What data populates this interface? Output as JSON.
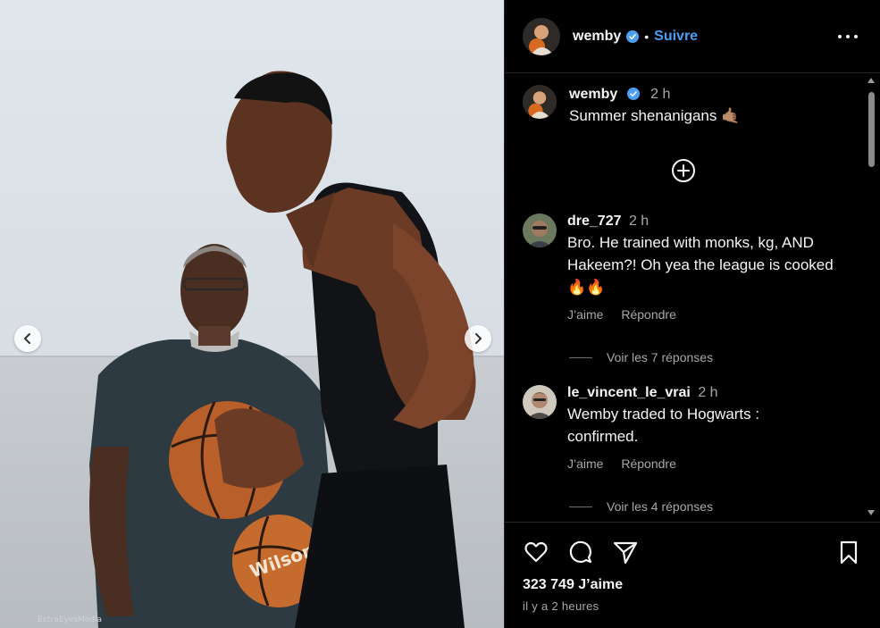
{
  "photo": {
    "watermark": "ExtraEyesMedia",
    "prev_icon": "chevron-left-icon",
    "next_icon": "chevron-right-icon"
  },
  "header": {
    "username": "wemby",
    "separator": "•",
    "follow_label": "Suivre",
    "more_icon": "more-options-icon"
  },
  "caption": {
    "username": "wemby",
    "time": "2 h",
    "text": "Summer shenanigans 🤙🏽"
  },
  "load_more_icon": "plus-circle-icon",
  "comments": [
    {
      "username": "dre_727",
      "time": "2 h",
      "text": "Bro. He trained with monks, kg, AND Hakeem?! Oh yea the league is cooked 🔥🔥",
      "like_label": "J’aime",
      "reply_label": "Répondre",
      "view_replies": "Voir les 7 réponses"
    },
    {
      "username": "le_vincent_le_vrai",
      "time": "2 h",
      "text": "Wemby traded to Hogwarts : confirmed.",
      "like_label": "J’aime",
      "reply_label": "Répondre",
      "view_replies": "Voir les 4 réponses"
    }
  ],
  "footer": {
    "likes": "323 749 J’aime",
    "posted": "il y a 2 heures"
  },
  "colors": {
    "accent": "#4a9ff5",
    "background": "#000000",
    "secondary_text": "#a8a8a8",
    "flame": "#ff6a1a"
  }
}
